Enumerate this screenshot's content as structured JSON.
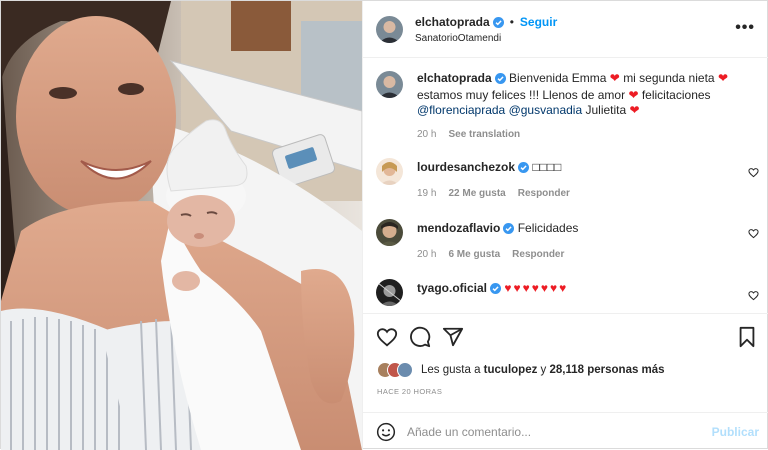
{
  "post": {
    "author": "elchatoprada",
    "follow_label": "Seguir",
    "location": "SanatorioOtamendi",
    "more_icon": "more-horizontal-icon",
    "caption": {
      "text1": "Bienvenida Emma",
      "text2": "mi segunda nieta",
      "text3": "estamos muy felices !!! Llenos de amor",
      "text4": "felicitaciones",
      "mention1": "@florenciaprada",
      "mention2": "@gusvanadia",
      "text5": "Julietita",
      "time": "20 h",
      "translate": "See translation"
    }
  },
  "comments": [
    {
      "user": "lourdesanchezok",
      "text": "□□□□",
      "time": "19 h",
      "likes": "22 Me gusta",
      "reply": "Responder"
    },
    {
      "user": "mendozaflavio",
      "text": "Felicidades",
      "time": "20 h",
      "likes": "6 Me gusta",
      "reply": "Responder"
    },
    {
      "user": "tyago.oficial",
      "text": "♥♥♥♥♥♥♥",
      "time": "",
      "likes": "",
      "reply": ""
    }
  ],
  "actions": {
    "like_icon": "heart-icon",
    "comment_icon": "comment-icon",
    "share_icon": "send-icon",
    "save_icon": "bookmark-icon"
  },
  "likes": {
    "prefix": "Les gusta a",
    "user": "tuculopez",
    "middle": "y",
    "count": "28,118 personas más"
  },
  "timestamp": "HACE 20 HORAS",
  "add_comment": {
    "placeholder": "Añade un comentario...",
    "publish_label": "Publicar",
    "emoji_icon": "emoji-icon"
  },
  "colors": {
    "accent": "#0095f6",
    "heart": "#ed1c24",
    "muted": "#8e8e8e",
    "publish_disabled": "#b2dffc"
  }
}
